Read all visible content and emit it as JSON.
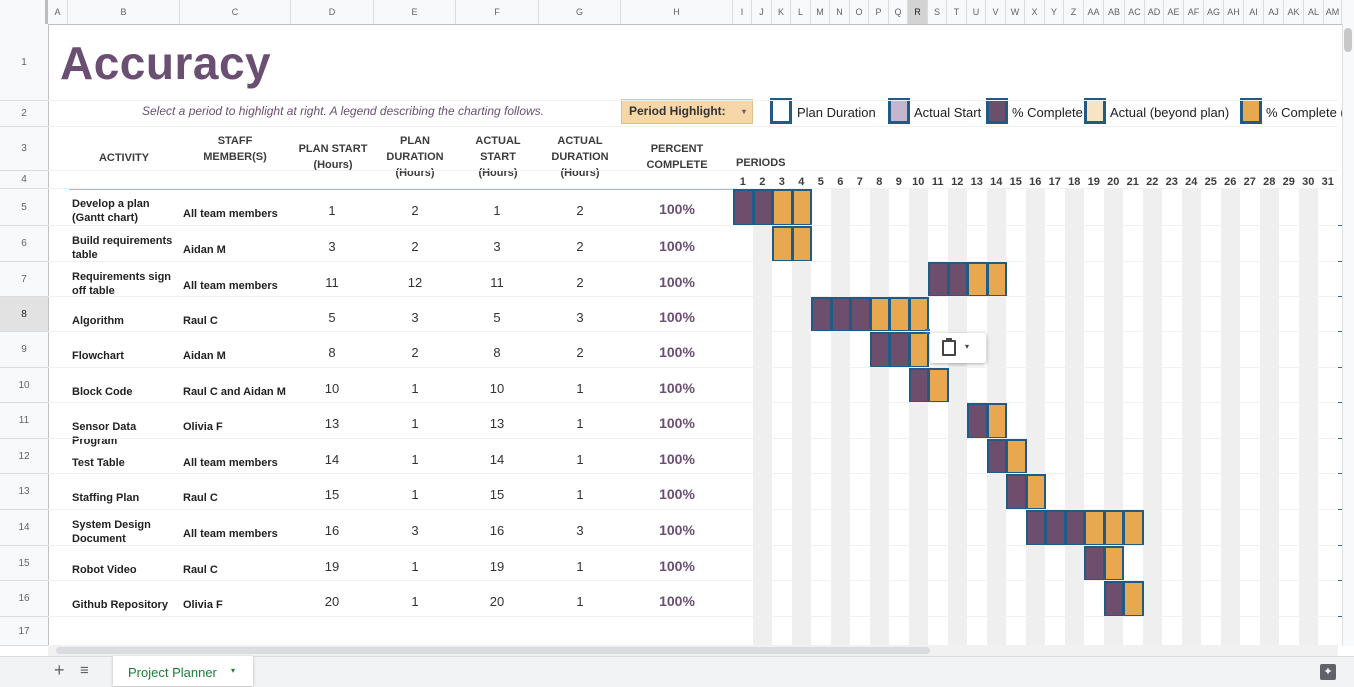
{
  "columns": [
    "A",
    "B",
    "C",
    "D",
    "E",
    "F",
    "G",
    "H",
    "I",
    "J",
    "K",
    "L",
    "M",
    "N",
    "O",
    "P",
    "Q",
    "R",
    "S",
    "T",
    "U",
    "V",
    "W",
    "X",
    "Y",
    "Z",
    "AA",
    "AB",
    "AC",
    "AD",
    "AE",
    "AF",
    "AG",
    "AH",
    "AI",
    "AJ",
    "AK",
    "AL",
    "AM"
  ],
  "rows": [
    "1",
    "2",
    "3",
    "4",
    "5",
    "6",
    "7",
    "8",
    "9",
    "10",
    "11",
    "12",
    "13",
    "14",
    "15",
    "16",
    "17"
  ],
  "title": "Accuracy",
  "subtitle": "Select a period to highlight at right.  A legend describing the charting follows.",
  "period_highlight": {
    "label": "Period Highlight:",
    "arrow": "▾"
  },
  "legend": [
    {
      "label": "Plan Duration",
      "fill": "#ffffff"
    },
    {
      "label": "Actual Start",
      "fill": "#c5b6cf"
    },
    {
      "label": "% Complete",
      "fill": "#6e4e6d"
    },
    {
      "label": "Actual (beyond plan)",
      "fill": "#f7e4c4"
    },
    {
      "label": "% Complete (",
      "fill": "#e8a84f"
    }
  ],
  "headers": {
    "activity": "ACTIVITY",
    "staff": "STAFF\nMEMBER(S)",
    "plan_start": "PLAN START\n(Hours)",
    "plan_duration": "PLAN\nDURATION\n(Hours)",
    "actual_start": "ACTUAL\nSTART\n(Hours)",
    "actual_duration": "ACTUAL\nDURATION\n(Hours)",
    "percent": "PERCENT\nCOMPLETE",
    "periods": "PERIODS"
  },
  "periods": [
    1,
    2,
    3,
    4,
    5,
    6,
    7,
    8,
    9,
    10,
    11,
    12,
    13,
    14,
    15,
    16,
    17,
    18,
    19,
    20,
    21,
    22,
    23,
    24,
    25,
    26,
    27,
    28,
    29,
    30,
    31
  ],
  "tasks": [
    {
      "activity": "Develop a plan\n(Gantt chart)",
      "staff": "All team members",
      "plan_start": 1,
      "plan_duration": 2,
      "actual_start": 1,
      "actual_duration": 2,
      "percent": "100%"
    },
    {
      "activity": "Build requirements\ntable",
      "staff": "Aidan M",
      "plan_start": 3,
      "plan_duration": 2,
      "actual_start": 3,
      "actual_duration": 2,
      "percent": "100%"
    },
    {
      "activity": "Requirements sign\noff table",
      "staff": "All team members",
      "plan_start": 11,
      "plan_duration": 12,
      "actual_start": 11,
      "actual_duration": 2,
      "percent": "100%"
    },
    {
      "activity": "Algorithm",
      "staff": "Raul C",
      "plan_start": 5,
      "plan_duration": 3,
      "actual_start": 5,
      "actual_duration": 3,
      "percent": "100%"
    },
    {
      "activity": "Flowchart",
      "staff": "Aidan M",
      "plan_start": 8,
      "plan_duration": 2,
      "actual_start": 8,
      "actual_duration": 2,
      "percent": "100%"
    },
    {
      "activity": "Block Code",
      "staff": "Raul C and Aidan M",
      "plan_start": 10,
      "plan_duration": 1,
      "actual_start": 10,
      "actual_duration": 1,
      "percent": "100%"
    },
    {
      "activity": "Sensor Data Program",
      "staff": "Olivia F",
      "plan_start": 13,
      "plan_duration": 1,
      "actual_start": 13,
      "actual_duration": 1,
      "percent": "100%"
    },
    {
      "activity": "Test Table",
      "staff": "All team members",
      "plan_start": 14,
      "plan_duration": 1,
      "actual_start": 14,
      "actual_duration": 1,
      "percent": "100%"
    },
    {
      "activity": "Staffing Plan",
      "staff": "Raul C",
      "plan_start": 15,
      "plan_duration": 1,
      "actual_start": 15,
      "actual_duration": 1,
      "percent": "100%"
    },
    {
      "activity": "System Design\nDocument",
      "staff": "All team members",
      "plan_start": 16,
      "plan_duration": 3,
      "actual_start": 16,
      "actual_duration": 3,
      "percent": "100%"
    },
    {
      "activity": "Robot Video",
      "staff": "Raul C",
      "plan_start": 19,
      "plan_duration": 1,
      "actual_start": 19,
      "actual_duration": 1,
      "percent": "100%"
    },
    {
      "activity": "Github Repository",
      "staff": "Olivia F",
      "plan_start": 20,
      "plan_duration": 1,
      "actual_start": 20,
      "actual_duration": 1,
      "percent": "100%"
    }
  ],
  "gantt": [
    {
      "purple": [
        1,
        2
      ],
      "orange": [
        3,
        4
      ]
    },
    {
      "purple": [],
      "orange": [
        3,
        4
      ]
    },
    {
      "purple": [
        11,
        12
      ],
      "orange": [
        13,
        14
      ]
    },
    {
      "purple": [
        5,
        6,
        7
      ],
      "orange": [
        8,
        9,
        10
      ]
    },
    {
      "purple": [
        8,
        9
      ],
      "orange": [
        10
      ]
    },
    {
      "purple": [
        10
      ],
      "orange": [
        11
      ]
    },
    {
      "purple": [
        13
      ],
      "orange": [
        14
      ]
    },
    {
      "purple": [
        14
      ],
      "orange": [
        15
      ]
    },
    {
      "purple": [
        15
      ],
      "orange": [
        16
      ]
    },
    {
      "purple": [
        16,
        17,
        18
      ],
      "orange": [
        19,
        20,
        21
      ]
    },
    {
      "purple": [
        19
      ],
      "orange": [
        20
      ]
    },
    {
      "purple": [
        20
      ],
      "orange": [
        21
      ]
    }
  ],
  "sheet_tab": {
    "label": "Project Planner",
    "arrow": "▾"
  },
  "bottom": {
    "add": "+",
    "all_sheets": "≡"
  },
  "colors": {
    "title": "#6b4f73",
    "bar_border": "#1f5b85",
    "purple": "#6e4e6d",
    "orange": "#e8a84f",
    "tab_green": "#188038"
  }
}
